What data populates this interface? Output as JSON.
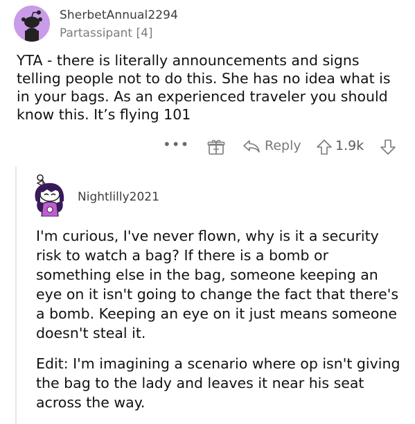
{
  "parent_comment": {
    "username": "SherbetAnnual2294",
    "flair": "Partassipant [4]",
    "body": "YTA - there is literally announcements and signs telling people not to do this. She has no idea what is in your bags. As an experienced traveler you should know this. It’s flying 101",
    "actions": {
      "more": "•••",
      "reply_label": "Reply",
      "score": "1.9k"
    },
    "icons": [
      "more-icon",
      "award-icon",
      "reply-icon",
      "upvote-icon",
      "downvote-icon"
    ]
  },
  "reply_comment": {
    "username": "Nightlilly2021",
    "paragraph_1": "I'm curious, I've never flown, why is it a security risk to watch a bag? If there is a bomb or something else in the bag, someone keeping an eye on it isn't going to change the fact that there's a bomb. Keeping an eye on it just means someone doesn't steal it.",
    "paragraph_2": "Edit: I'm imagining a scenario where op isn't giving the bag to the lady and leaves it near his seat across the way."
  },
  "colors": {
    "avatar_bg": "#c99be8",
    "icon_gray": "#7a7a7a",
    "text": "#111111",
    "meta_text": "#7c7c7c"
  }
}
